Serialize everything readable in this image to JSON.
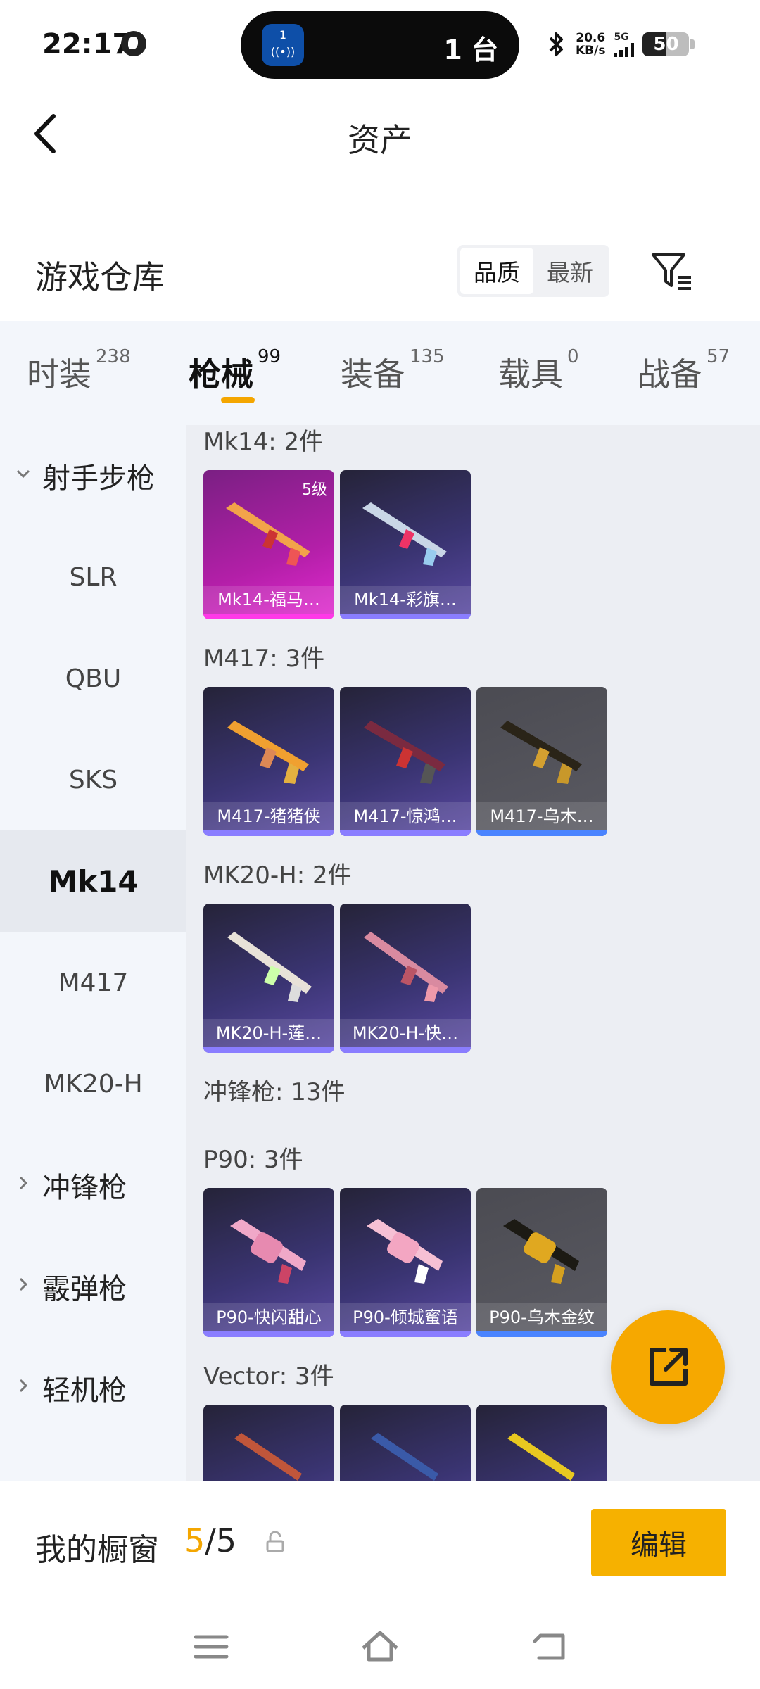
{
  "status_bar": {
    "time": "22:17",
    "island_app_number": "1",
    "island_count": "1 台",
    "speed_value": "20.6",
    "speed_unit": "KB/s",
    "network": "5G",
    "battery": "50",
    "battery_level": 0.5
  },
  "header": {
    "title": "资产"
  },
  "warehouse": {
    "title": "游戏仓库",
    "sort_options": [
      "品质",
      "最新"
    ],
    "sort_active": "品质"
  },
  "tabs": [
    {
      "label": "时装",
      "count": "238"
    },
    {
      "label": "枪械",
      "count": "99"
    },
    {
      "label": "装备",
      "count": "135"
    },
    {
      "label": "载具",
      "count": "0"
    },
    {
      "label": "战备",
      "count": "57"
    }
  ],
  "active_tab": "枪械",
  "sidebar": {
    "groups": [
      {
        "label": "射手步枪",
        "expanded": true
      },
      {
        "label": "冲锋枪",
        "expanded": false
      },
      {
        "label": "霰弹枪",
        "expanded": false
      },
      {
        "label": "轻机枪",
        "expanded": false
      }
    ],
    "items": [
      "SLR",
      "QBU",
      "SKS",
      "Mk14",
      "M417",
      "MK20-H"
    ],
    "active_item": "Mk14"
  },
  "sections": {
    "mk14": "Mk14: 2件",
    "m417": "M417: 3件",
    "mk20h": "MK20-H: 2件",
    "smg": "冲锋枪: 13件",
    "p90": "P90: 3件",
    "vector": "Vector: 3件"
  },
  "cards": {
    "mk14": [
      {
        "name": "Mk14-福马…",
        "level": "5级",
        "rarity": "pink"
      },
      {
        "name": "Mk14-彩旗…",
        "rarity": "purple"
      }
    ],
    "m417": [
      {
        "name": "M417-猪猪侠",
        "rarity": "purple"
      },
      {
        "name": "M417-惊鸿…",
        "rarity": "purple"
      },
      {
        "name": "M417-乌木…",
        "rarity": "gray"
      }
    ],
    "mk20h": [
      {
        "name": "MK20-H-莲…",
        "rarity": "purple"
      },
      {
        "name": "MK20-H-快…",
        "rarity": "purple"
      }
    ],
    "p90": [
      {
        "name": "P90-快闪甜心",
        "rarity": "purple"
      },
      {
        "name": "P90-倾城蜜语",
        "rarity": "purple"
      },
      {
        "name": "P90-乌木金纹",
        "rarity": "gray"
      }
    ],
    "vector": [
      {
        "rarity": "purple"
      },
      {
        "rarity": "purple"
      },
      {
        "rarity": "purple"
      }
    ]
  },
  "showcase": {
    "label": "我的橱窗",
    "current": "5",
    "separator": "/",
    "total": "5",
    "edit_label": "编辑"
  },
  "colors": {
    "accent": "#f4a600",
    "tab_bg": "#f3f6fb",
    "main_bg": "#eceef3"
  }
}
